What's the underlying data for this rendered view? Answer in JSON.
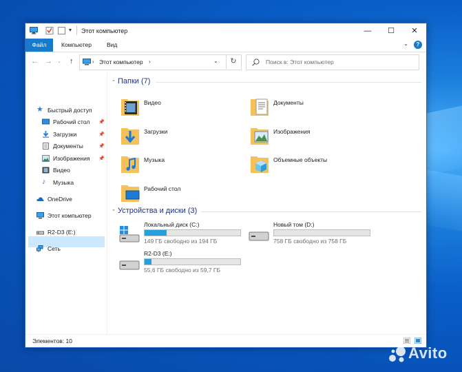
{
  "window": {
    "title": "Этот компьютер",
    "controls": {
      "minimize": "—",
      "maximize": "☐",
      "close": "✕"
    }
  },
  "ribbon": {
    "file": "Файл",
    "tabs": [
      "Компьютер",
      "Вид"
    ],
    "help": "?"
  },
  "address": {
    "path": "Этот компьютер",
    "separator": "›",
    "search_placeholder": "Поиск в: Этот компьютер"
  },
  "nav": {
    "quick_access": "Быстрый доступ",
    "quick_items": [
      {
        "label": "Рабочий стол",
        "pinned": true
      },
      {
        "label": "Загрузки",
        "pinned": true
      },
      {
        "label": "Документы",
        "pinned": true
      },
      {
        "label": "Изображения",
        "pinned": true
      },
      {
        "label": "Видео",
        "pinned": false
      },
      {
        "label": "Музыка",
        "pinned": false
      }
    ],
    "onedrive": "OneDrive",
    "this_pc": "Этот компьютер",
    "drive": "R2-D3 (E:)",
    "network": "Сеть"
  },
  "folders_group": {
    "title": "Папки (7)",
    "items": [
      {
        "name": "Видео",
        "icon": "video-folder-icon"
      },
      {
        "name": "Документы",
        "icon": "documents-folder-icon"
      },
      {
        "name": "Загрузки",
        "icon": "downloads-folder-icon"
      },
      {
        "name": "Изображения",
        "icon": "pictures-folder-icon"
      },
      {
        "name": "Музыка",
        "icon": "music-folder-icon"
      },
      {
        "name": "Объемные объекты",
        "icon": "3d-objects-folder-icon"
      },
      {
        "name": "Рабочий стол",
        "icon": "desktop-folder-icon"
      }
    ]
  },
  "drives_group": {
    "title": "Устройства и диски (3)",
    "items": [
      {
        "name": "Локальный диск (C:)",
        "free": "149 ГБ свободно из 194 ГБ",
        "used_fraction": 0.23,
        "icon": "windows-drive-icon"
      },
      {
        "name": "Новый том (D:)",
        "free": "758 ГБ свободно из 758 ГБ",
        "used_fraction": 0.0,
        "icon": "hard-drive-icon"
      },
      {
        "name": "R2-D3 (E:)",
        "free": "55,6 ГБ свободно из 59,7 ГБ",
        "used_fraction": 0.07,
        "icon": "hard-drive-icon"
      }
    ]
  },
  "status": {
    "items_count": "Элементов: 10"
  },
  "colors": {
    "accent": "#1979ca",
    "selection": "#cce8ff",
    "progress": "#26a0da",
    "group_header": "#1e3287"
  },
  "watermark": "Avito"
}
